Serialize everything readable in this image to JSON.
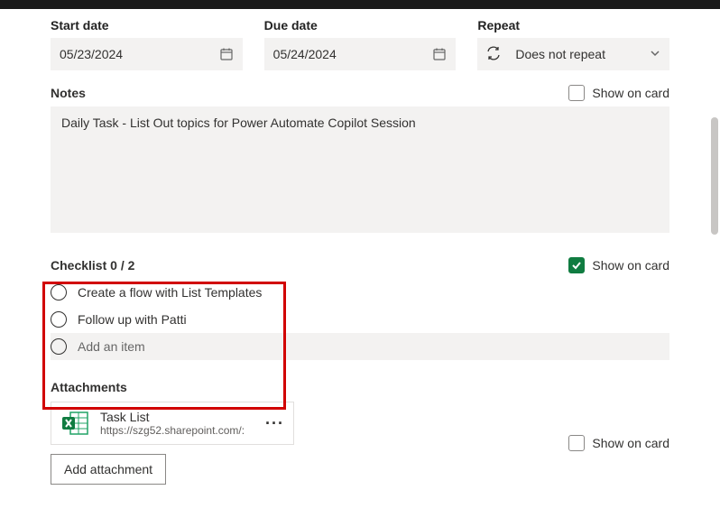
{
  "fields": {
    "start_date": {
      "label": "Start date",
      "value": "05/23/2024"
    },
    "due_date": {
      "label": "Due date",
      "value": "05/24/2024"
    },
    "repeat": {
      "label": "Repeat",
      "value": "Does not repeat"
    }
  },
  "notes": {
    "label": "Notes",
    "value": "Daily Task - List Out topics for Power Automate Copilot Session",
    "show_on_card_label": "Show on card"
  },
  "checklist": {
    "label": "Checklist 0 / 2",
    "show_on_card_label": "Show on card",
    "items": [
      {
        "text": "Create a flow with List Templates"
      },
      {
        "text": "Follow up with Patti"
      }
    ],
    "add_placeholder": "Add an item"
  },
  "attachments": {
    "label": "Attachments",
    "show_on_card_label": "Show on card",
    "items": [
      {
        "title": "Task List",
        "subtitle": "https://szg52.sharepoint.com/:"
      }
    ],
    "add_button": "Add attachment"
  }
}
